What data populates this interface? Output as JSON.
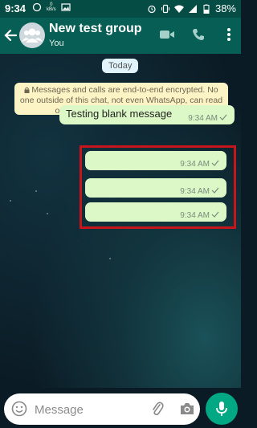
{
  "status_bar": {
    "time": "9:34",
    "speed_value": "0",
    "speed_unit": "kB/s",
    "battery": "38%"
  },
  "header": {
    "title": "New test group",
    "subtitle": "You"
  },
  "chat": {
    "date_label": "Today",
    "encryption_notice": "Messages and calls are end-to-end encrypted. No one outside of this chat, not even WhatsApp, can read or listen to them. Tap to learn more.",
    "messages": [
      {
        "text": "Testing blank message",
        "time": "9:34 AM"
      },
      {
        "text": "",
        "time": "9:34 AM"
      },
      {
        "text": "",
        "time": "9:34 AM"
      },
      {
        "text": "",
        "time": "9:34 AM"
      }
    ]
  },
  "composer": {
    "placeholder": "Message"
  },
  "colors": {
    "header": "#075e54",
    "status_bar": "#054d44",
    "outgoing_bubble": "#dcf8c6",
    "accent": "#00a884",
    "highlight_box": "#c8151b"
  }
}
